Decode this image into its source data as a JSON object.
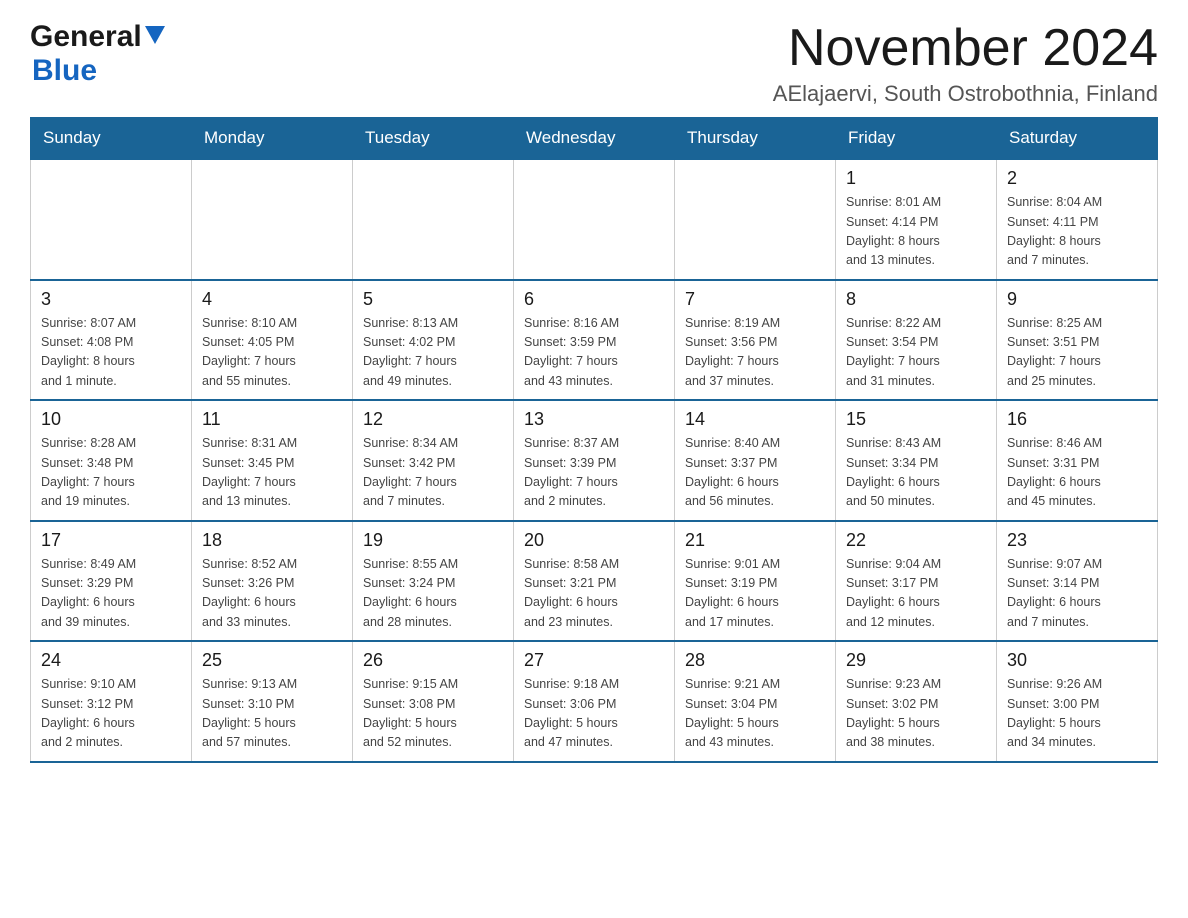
{
  "header": {
    "logo_general": "General",
    "logo_blue": "Blue",
    "month_title": "November 2024",
    "location": "AElajaervi, South Ostrobothnia, Finland"
  },
  "days_of_week": [
    "Sunday",
    "Monday",
    "Tuesday",
    "Wednesday",
    "Thursday",
    "Friday",
    "Saturday"
  ],
  "weeks": [
    [
      {
        "day": "",
        "info": ""
      },
      {
        "day": "",
        "info": ""
      },
      {
        "day": "",
        "info": ""
      },
      {
        "day": "",
        "info": ""
      },
      {
        "day": "",
        "info": ""
      },
      {
        "day": "1",
        "info": "Sunrise: 8:01 AM\nSunset: 4:14 PM\nDaylight: 8 hours\nand 13 minutes."
      },
      {
        "day": "2",
        "info": "Sunrise: 8:04 AM\nSunset: 4:11 PM\nDaylight: 8 hours\nand 7 minutes."
      }
    ],
    [
      {
        "day": "3",
        "info": "Sunrise: 8:07 AM\nSunset: 4:08 PM\nDaylight: 8 hours\nand 1 minute."
      },
      {
        "day": "4",
        "info": "Sunrise: 8:10 AM\nSunset: 4:05 PM\nDaylight: 7 hours\nand 55 minutes."
      },
      {
        "day": "5",
        "info": "Sunrise: 8:13 AM\nSunset: 4:02 PM\nDaylight: 7 hours\nand 49 minutes."
      },
      {
        "day": "6",
        "info": "Sunrise: 8:16 AM\nSunset: 3:59 PM\nDaylight: 7 hours\nand 43 minutes."
      },
      {
        "day": "7",
        "info": "Sunrise: 8:19 AM\nSunset: 3:56 PM\nDaylight: 7 hours\nand 37 minutes."
      },
      {
        "day": "8",
        "info": "Sunrise: 8:22 AM\nSunset: 3:54 PM\nDaylight: 7 hours\nand 31 minutes."
      },
      {
        "day": "9",
        "info": "Sunrise: 8:25 AM\nSunset: 3:51 PM\nDaylight: 7 hours\nand 25 minutes."
      }
    ],
    [
      {
        "day": "10",
        "info": "Sunrise: 8:28 AM\nSunset: 3:48 PM\nDaylight: 7 hours\nand 19 minutes."
      },
      {
        "day": "11",
        "info": "Sunrise: 8:31 AM\nSunset: 3:45 PM\nDaylight: 7 hours\nand 13 minutes."
      },
      {
        "day": "12",
        "info": "Sunrise: 8:34 AM\nSunset: 3:42 PM\nDaylight: 7 hours\nand 7 minutes."
      },
      {
        "day": "13",
        "info": "Sunrise: 8:37 AM\nSunset: 3:39 PM\nDaylight: 7 hours\nand 2 minutes."
      },
      {
        "day": "14",
        "info": "Sunrise: 8:40 AM\nSunset: 3:37 PM\nDaylight: 6 hours\nand 56 minutes."
      },
      {
        "day": "15",
        "info": "Sunrise: 8:43 AM\nSunset: 3:34 PM\nDaylight: 6 hours\nand 50 minutes."
      },
      {
        "day": "16",
        "info": "Sunrise: 8:46 AM\nSunset: 3:31 PM\nDaylight: 6 hours\nand 45 minutes."
      }
    ],
    [
      {
        "day": "17",
        "info": "Sunrise: 8:49 AM\nSunset: 3:29 PM\nDaylight: 6 hours\nand 39 minutes."
      },
      {
        "day": "18",
        "info": "Sunrise: 8:52 AM\nSunset: 3:26 PM\nDaylight: 6 hours\nand 33 minutes."
      },
      {
        "day": "19",
        "info": "Sunrise: 8:55 AM\nSunset: 3:24 PM\nDaylight: 6 hours\nand 28 minutes."
      },
      {
        "day": "20",
        "info": "Sunrise: 8:58 AM\nSunset: 3:21 PM\nDaylight: 6 hours\nand 23 minutes."
      },
      {
        "day": "21",
        "info": "Sunrise: 9:01 AM\nSunset: 3:19 PM\nDaylight: 6 hours\nand 17 minutes."
      },
      {
        "day": "22",
        "info": "Sunrise: 9:04 AM\nSunset: 3:17 PM\nDaylight: 6 hours\nand 12 minutes."
      },
      {
        "day": "23",
        "info": "Sunrise: 9:07 AM\nSunset: 3:14 PM\nDaylight: 6 hours\nand 7 minutes."
      }
    ],
    [
      {
        "day": "24",
        "info": "Sunrise: 9:10 AM\nSunset: 3:12 PM\nDaylight: 6 hours\nand 2 minutes."
      },
      {
        "day": "25",
        "info": "Sunrise: 9:13 AM\nSunset: 3:10 PM\nDaylight: 5 hours\nand 57 minutes."
      },
      {
        "day": "26",
        "info": "Sunrise: 9:15 AM\nSunset: 3:08 PM\nDaylight: 5 hours\nand 52 minutes."
      },
      {
        "day": "27",
        "info": "Sunrise: 9:18 AM\nSunset: 3:06 PM\nDaylight: 5 hours\nand 47 minutes."
      },
      {
        "day": "28",
        "info": "Sunrise: 9:21 AM\nSunset: 3:04 PM\nDaylight: 5 hours\nand 43 minutes."
      },
      {
        "day": "29",
        "info": "Sunrise: 9:23 AM\nSunset: 3:02 PM\nDaylight: 5 hours\nand 38 minutes."
      },
      {
        "day": "30",
        "info": "Sunrise: 9:26 AM\nSunset: 3:00 PM\nDaylight: 5 hours\nand 34 minutes."
      }
    ]
  ]
}
